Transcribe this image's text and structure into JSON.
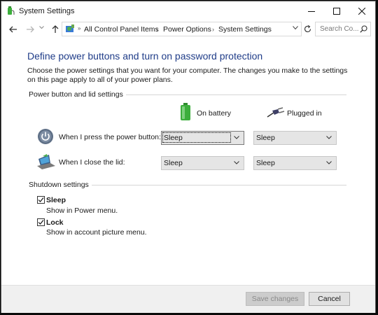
{
  "window": {
    "title": "System Settings"
  },
  "address_bar": {
    "breadcrumbs": [
      "All Control Panel Items",
      "Power Options",
      "System Settings"
    ],
    "search_placeholder": "Search Co..."
  },
  "page": {
    "heading": "Define power buttons and turn on password protection",
    "description": "Choose the power settings that you want for your computer. The changes you make to the settings on this page apply to all of your power plans."
  },
  "power_group": {
    "label": "Power button and lid settings",
    "columns": {
      "on_battery": "On battery",
      "plugged_in": "Plugged in"
    },
    "rows": [
      {
        "label": "When I press the power button:",
        "on_battery": "Sleep",
        "plugged_in": "Sleep"
      },
      {
        "label": "When I close the lid:",
        "on_battery": "Sleep",
        "plugged_in": "Sleep"
      }
    ]
  },
  "shutdown_group": {
    "label": "Shutdown settings",
    "items": [
      {
        "title": "Sleep",
        "subtitle": "Show in Power menu.",
        "checked": true
      },
      {
        "title": "Lock",
        "subtitle": "Show in account picture menu.",
        "checked": true
      }
    ]
  },
  "footer": {
    "save_label": "Save changes",
    "cancel_label": "Cancel"
  },
  "colors": {
    "heading": "#1f3c88",
    "battery_green": "#3cae3c",
    "window_border": "#5a5a5a"
  },
  "icons": [
    "power-options-icon",
    "back-arrow-icon",
    "forward-arrow-icon",
    "up-arrow-icon",
    "control-panel-icon",
    "refresh-icon",
    "search-icon",
    "battery-icon",
    "power-plug-icon",
    "power-button-icon",
    "laptop-lid-icon",
    "checkmark-icon"
  ]
}
